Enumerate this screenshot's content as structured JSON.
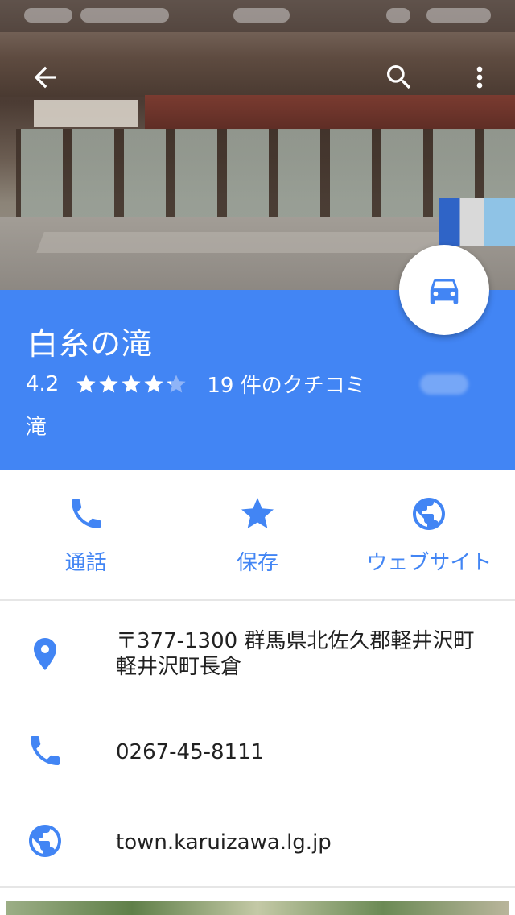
{
  "header": {
    "back_icon": "arrow-back-icon",
    "search_icon": "search-icon",
    "more_icon": "more-vert-icon"
  },
  "place": {
    "name": "白糸の滝",
    "rating": "4.2",
    "rating_value": 4.2,
    "rating_max": 5,
    "review_count": "19 件のクチコミ",
    "category": "滝"
  },
  "fab": {
    "icon": "car-icon"
  },
  "actions": [
    {
      "label": "通話",
      "icon": "phone-icon"
    },
    {
      "label": "保存",
      "icon": "star-icon"
    },
    {
      "label": "ウェブサイト",
      "icon": "globe-icon"
    }
  ],
  "details": {
    "address_line1": "〒377-1300 群馬県北佐久郡軽井沢町",
    "address_line2": "軽井沢町長倉",
    "phone": "0267-45-8111",
    "website": "town.karuizawa.lg.jp"
  },
  "colors": {
    "accent": "#4285f4",
    "panel": "#4285f4",
    "text": "#212121"
  }
}
